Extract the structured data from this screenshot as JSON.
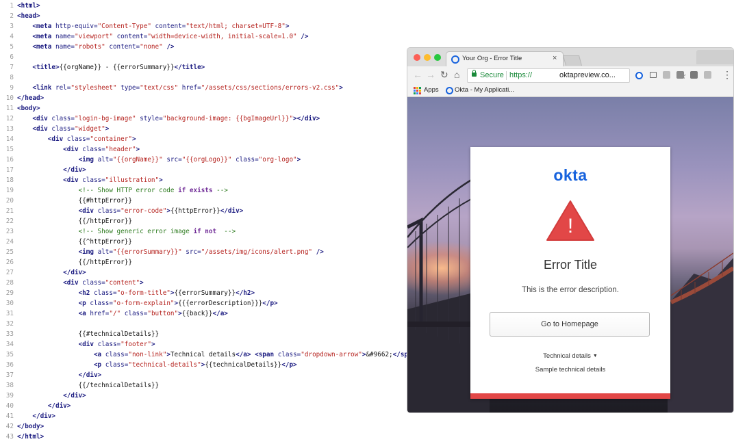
{
  "code": {
    "lines": [
      [
        {
          "t": "tag",
          "v": "<html>"
        }
      ],
      [
        {
          "t": "tag",
          "v": "<head>"
        }
      ],
      [
        {
          "t": "pl",
          "v": "    "
        },
        {
          "t": "tag",
          "v": "<meta "
        },
        {
          "t": "attr",
          "v": "http-equiv="
        },
        {
          "t": "str",
          "v": "\"Content-Type\""
        },
        {
          "t": "attr",
          "v": " content="
        },
        {
          "t": "str",
          "v": "\"text/html; charset=UTF-8\""
        },
        {
          "t": "tag",
          "v": ">"
        }
      ],
      [
        {
          "t": "pl",
          "v": "    "
        },
        {
          "t": "tag",
          "v": "<meta "
        },
        {
          "t": "attr",
          "v": "name="
        },
        {
          "t": "str",
          "v": "\"viewport\""
        },
        {
          "t": "attr",
          "v": " content="
        },
        {
          "t": "str",
          "v": "\"width=device-width, initial-scale=1.0\""
        },
        {
          "t": "tag",
          "v": " />"
        }
      ],
      [
        {
          "t": "pl",
          "v": "    "
        },
        {
          "t": "tag",
          "v": "<meta "
        },
        {
          "t": "attr",
          "v": "name="
        },
        {
          "t": "str",
          "v": "\"robots\""
        },
        {
          "t": "attr",
          "v": " content="
        },
        {
          "t": "str",
          "v": "\"none\""
        },
        {
          "t": "tag",
          "v": " />"
        }
      ],
      [],
      [
        {
          "t": "pl",
          "v": "    "
        },
        {
          "t": "tag",
          "v": "<title>"
        },
        {
          "t": "pl",
          "v": "{{orgName}} - {{errorSummary}}"
        },
        {
          "t": "tag",
          "v": "</title>"
        }
      ],
      [],
      [
        {
          "t": "pl",
          "v": "    "
        },
        {
          "t": "tag",
          "v": "<link "
        },
        {
          "t": "attr",
          "v": "rel="
        },
        {
          "t": "str",
          "v": "\"stylesheet\""
        },
        {
          "t": "attr",
          "v": " type="
        },
        {
          "t": "str",
          "v": "\"text/css\""
        },
        {
          "t": "attr",
          "v": " href="
        },
        {
          "t": "str",
          "v": "\"/assets/css/sections/errors-v2.css\""
        },
        {
          "t": "tag",
          "v": ">"
        }
      ],
      [
        {
          "t": "tag",
          "v": "</head>"
        }
      ],
      [
        {
          "t": "tag",
          "v": "<body>"
        }
      ],
      [
        {
          "t": "pl",
          "v": "    "
        },
        {
          "t": "tag",
          "v": "<div "
        },
        {
          "t": "attr",
          "v": "class="
        },
        {
          "t": "str",
          "v": "\"login-bg-image\""
        },
        {
          "t": "attr",
          "v": " style="
        },
        {
          "t": "str",
          "v": "\"background-image: {{bgImageUrl}}\""
        },
        {
          "t": "tag",
          "v": "></div>"
        }
      ],
      [
        {
          "t": "pl",
          "v": "    "
        },
        {
          "t": "tag",
          "v": "<div "
        },
        {
          "t": "attr",
          "v": "class="
        },
        {
          "t": "str",
          "v": "\"widget\""
        },
        {
          "t": "tag",
          "v": ">"
        }
      ],
      [
        {
          "t": "pl",
          "v": "        "
        },
        {
          "t": "tag",
          "v": "<div "
        },
        {
          "t": "attr",
          "v": "class="
        },
        {
          "t": "str",
          "v": "\"container\""
        },
        {
          "t": "tag",
          "v": ">"
        }
      ],
      [
        {
          "t": "pl",
          "v": "            "
        },
        {
          "t": "tag",
          "v": "<div "
        },
        {
          "t": "attr",
          "v": "class="
        },
        {
          "t": "str",
          "v": "\"header\""
        },
        {
          "t": "tag",
          "v": ">"
        }
      ],
      [
        {
          "t": "pl",
          "v": "                "
        },
        {
          "t": "tag",
          "v": "<img "
        },
        {
          "t": "attr",
          "v": "alt="
        },
        {
          "t": "str",
          "v": "\"{{orgName}}\""
        },
        {
          "t": "attr",
          "v": " src="
        },
        {
          "t": "str",
          "v": "\"{{orgLogo}}\""
        },
        {
          "t": "attr",
          "v": " class="
        },
        {
          "t": "str",
          "v": "\"org-logo\""
        },
        {
          "t": "tag",
          "v": ">"
        }
      ],
      [
        {
          "t": "pl",
          "v": "            "
        },
        {
          "t": "tag",
          "v": "</div>"
        }
      ],
      [
        {
          "t": "pl",
          "v": "            "
        },
        {
          "t": "tag",
          "v": "<div "
        },
        {
          "t": "attr",
          "v": "class="
        },
        {
          "t": "str",
          "v": "\"illustration\""
        },
        {
          "t": "tag",
          "v": ">"
        }
      ],
      [
        {
          "t": "pl",
          "v": "                "
        },
        {
          "t": "com",
          "v": "<!-- Show HTTP error code "
        },
        {
          "t": "kw",
          "v": "if"
        },
        {
          "t": "com",
          "v": " "
        },
        {
          "t": "kw",
          "v": "exists"
        },
        {
          "t": "com",
          "v": " -->"
        }
      ],
      [
        {
          "t": "pl",
          "v": "                {{#httpError}}"
        }
      ],
      [
        {
          "t": "pl",
          "v": "                "
        },
        {
          "t": "tag",
          "v": "<div "
        },
        {
          "t": "attr",
          "v": "class="
        },
        {
          "t": "str",
          "v": "\"error-code\""
        },
        {
          "t": "tag",
          "v": ">"
        },
        {
          "t": "pl",
          "v": "{{httpError}}"
        },
        {
          "t": "tag",
          "v": "</div>"
        }
      ],
      [
        {
          "t": "pl",
          "v": "                {{/httpError}}"
        }
      ],
      [
        {
          "t": "pl",
          "v": "                "
        },
        {
          "t": "com",
          "v": "<!-- Show generic error image "
        },
        {
          "t": "kw",
          "v": "if not"
        },
        {
          "t": "com",
          "v": "  -->"
        }
      ],
      [
        {
          "t": "pl",
          "v": "                {{^httpError}}"
        }
      ],
      [
        {
          "t": "pl",
          "v": "                "
        },
        {
          "t": "tag",
          "v": "<img "
        },
        {
          "t": "attr",
          "v": "alt="
        },
        {
          "t": "str",
          "v": "\"{{errorSummary}}\""
        },
        {
          "t": "attr",
          "v": " src="
        },
        {
          "t": "str",
          "v": "\"/assets/img/icons/alert.png\""
        },
        {
          "t": "tag",
          "v": " />"
        }
      ],
      [
        {
          "t": "pl",
          "v": "                {{/httpError}}"
        }
      ],
      [
        {
          "t": "pl",
          "v": "            "
        },
        {
          "t": "tag",
          "v": "</div>"
        }
      ],
      [
        {
          "t": "pl",
          "v": "            "
        },
        {
          "t": "tag",
          "v": "<div "
        },
        {
          "t": "attr",
          "v": "class="
        },
        {
          "t": "str",
          "v": "\"content\""
        },
        {
          "t": "tag",
          "v": ">"
        }
      ],
      [
        {
          "t": "pl",
          "v": "                "
        },
        {
          "t": "tag",
          "v": "<h2 "
        },
        {
          "t": "attr",
          "v": "class="
        },
        {
          "t": "str",
          "v": "\"o-form-title\""
        },
        {
          "t": "tag",
          "v": ">"
        },
        {
          "t": "pl",
          "v": "{{errorSummary}}"
        },
        {
          "t": "tag",
          "v": "</h2>"
        }
      ],
      [
        {
          "t": "pl",
          "v": "                "
        },
        {
          "t": "tag",
          "v": "<p "
        },
        {
          "t": "attr",
          "v": "class="
        },
        {
          "t": "str",
          "v": "\"o-form-explain\""
        },
        {
          "t": "tag",
          "v": ">"
        },
        {
          "t": "pl",
          "v": "{{{errorDescription}}}"
        },
        {
          "t": "tag",
          "v": "</p>"
        }
      ],
      [
        {
          "t": "pl",
          "v": "                "
        },
        {
          "t": "tag",
          "v": "<a "
        },
        {
          "t": "attr",
          "v": "href="
        },
        {
          "t": "str",
          "v": "\"/\""
        },
        {
          "t": "attr",
          "v": " class="
        },
        {
          "t": "str",
          "v": "\"button\""
        },
        {
          "t": "tag",
          "v": ">"
        },
        {
          "t": "pl",
          "v": "{{back}}"
        },
        {
          "t": "tag",
          "v": "</a>"
        }
      ],
      [],
      [
        {
          "t": "pl",
          "v": "                {{#technicalDetails}}"
        }
      ],
      [
        {
          "t": "pl",
          "v": "                "
        },
        {
          "t": "tag",
          "v": "<div "
        },
        {
          "t": "attr",
          "v": "class="
        },
        {
          "t": "str",
          "v": "\"footer\""
        },
        {
          "t": "tag",
          "v": ">"
        }
      ],
      [
        {
          "t": "pl",
          "v": "                    "
        },
        {
          "t": "tag",
          "v": "<a "
        },
        {
          "t": "attr",
          "v": "class="
        },
        {
          "t": "str",
          "v": "\"non-link\""
        },
        {
          "t": "tag",
          "v": ">"
        },
        {
          "t": "pl",
          "v": "Technical details"
        },
        {
          "t": "tag",
          "v": "</a>"
        },
        {
          "t": "pl",
          "v": " "
        },
        {
          "t": "tag",
          "v": "<span "
        },
        {
          "t": "attr",
          "v": "class="
        },
        {
          "t": "str",
          "v": "\"dropdown-arrow\""
        },
        {
          "t": "tag",
          "v": ">"
        },
        {
          "t": "pl",
          "v": "&#9662;"
        },
        {
          "t": "tag",
          "v": "</span>"
        }
      ],
      [
        {
          "t": "pl",
          "v": "                    "
        },
        {
          "t": "tag",
          "v": "<p "
        },
        {
          "t": "attr",
          "v": "class="
        },
        {
          "t": "str",
          "v": "\"technical-details\""
        },
        {
          "t": "tag",
          "v": ">"
        },
        {
          "t": "pl",
          "v": "{{technicalDetails}}"
        },
        {
          "t": "tag",
          "v": "</p>"
        }
      ],
      [
        {
          "t": "pl",
          "v": "                "
        },
        {
          "t": "tag",
          "v": "</div>"
        }
      ],
      [
        {
          "t": "pl",
          "v": "                {{/technicalDetails}}"
        }
      ],
      [
        {
          "t": "pl",
          "v": "            "
        },
        {
          "t": "tag",
          "v": "</div>"
        }
      ],
      [
        {
          "t": "pl",
          "v": "        "
        },
        {
          "t": "tag",
          "v": "</div>"
        }
      ],
      [
        {
          "t": "pl",
          "v": "    "
        },
        {
          "t": "tag",
          "v": "</div>"
        }
      ],
      [
        {
          "t": "tag",
          "v": "</body>"
        }
      ],
      [
        {
          "t": "tag",
          "v": "</html>"
        }
      ]
    ]
  },
  "browser": {
    "tab_title": "Your Org - Error Title",
    "tab_close": "×",
    "omnibox": {
      "secure_label": "Secure",
      "url_scheme": "https://",
      "url_host": "oktapreview.co..."
    },
    "bookmarks": {
      "apps_label": "Apps",
      "item_label": "Okta - My Applicati..."
    },
    "icons": {
      "back": "←",
      "forward": "→",
      "reload": "↻",
      "home": "⌂",
      "star": "☆",
      "menu": "⋮"
    }
  },
  "error_page": {
    "org_logo_text": "okta",
    "error_title": "Error Title",
    "error_description": "This is the error description.",
    "home_button_label": "Go to Homepage",
    "technical_details_link": "Technical details",
    "dropdown_arrow": "▼",
    "technical_details_text": "Sample technical details",
    "alert_mark": "!"
  },
  "colors": {
    "okta_blue": "#1662dd",
    "alert_red": "#e24747",
    "secure_green": "#1a8a3a"
  }
}
